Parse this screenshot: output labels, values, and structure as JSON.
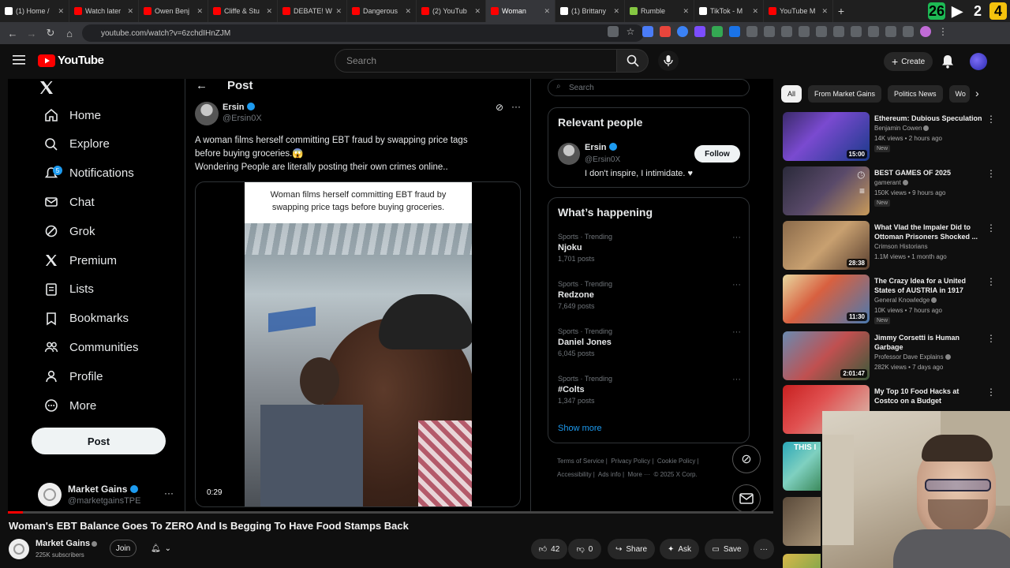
{
  "browser": {
    "tabs": [
      {
        "label": "(1) Home /",
        "favicon_color": "#ffffff"
      },
      {
        "label": "Watch later",
        "favicon_color": "#ff0000"
      },
      {
        "label": "Owen Benj",
        "favicon_color": "#ff0000"
      },
      {
        "label": "Cliffe & Stu",
        "favicon_color": "#ff0000"
      },
      {
        "label": "DEBATE! W",
        "favicon_color": "#ff0000"
      },
      {
        "label": "Dangerous",
        "favicon_color": "#ff0000"
      },
      {
        "label": "(2) YouTub",
        "favicon_color": "#ff0000"
      },
      {
        "label": "Woman",
        "favicon_color": "#ff0000",
        "active": true
      },
      {
        "label": "(1) Brittany",
        "favicon_color": "#ffffff"
      },
      {
        "label": "Rumble",
        "favicon_color": "#85c742"
      },
      {
        "label": "TikTok - M",
        "favicon_color": "#ffffff"
      },
      {
        "label": "YouTube M",
        "favicon_color": "#ff0000"
      }
    ],
    "url": "youtube.com/watch?v=6zchdIHnZJM",
    "hud": [
      "26",
      "2",
      "4"
    ]
  },
  "youtube": {
    "logo_text": "YouTube",
    "search_placeholder": "Search",
    "create_label": "Create"
  },
  "x_post": {
    "nav": [
      {
        "label": "Home",
        "icon": "home-icon"
      },
      {
        "label": "Explore",
        "icon": "search-icon"
      },
      {
        "label": "Notifications",
        "icon": "bell-icon"
      },
      {
        "label": "Chat",
        "icon": "mail-icon"
      },
      {
        "label": "Grok",
        "icon": "grok-icon"
      },
      {
        "label": "Premium",
        "icon": "x-icon"
      },
      {
        "label": "Lists",
        "icon": "list-icon"
      },
      {
        "label": "Bookmarks",
        "icon": "bookmark-icon"
      },
      {
        "label": "Communities",
        "icon": "people-icon"
      },
      {
        "label": "Profile",
        "icon": "person-icon"
      },
      {
        "label": "More",
        "icon": "more-circle-icon"
      }
    ],
    "notification_badge": "5",
    "post_button": "Post",
    "account_name": "Market Gains",
    "account_handle": "@marketgainsTPE",
    "header_title": "Post",
    "author_name": "Ersin",
    "author_handle": "@Ersin0X",
    "text_line1": "A woman films herself committing EBT fraud by swapping price tags",
    "text_line2": "before buying groceries.😱",
    "text_line3": "Wondering People are literally posting their own crimes online..",
    "video_caption": "Woman films herself committing EBT fraud by swapping price tags before buying groceries.",
    "video_time": "0:29",
    "search_placeholder": "Search",
    "relevant_title": "Relevant people",
    "relevant_name": "Ersin",
    "relevant_handle": "@Ersin0X",
    "relevant_bio": "I don't inspire, I intimidate. ♥",
    "follow_label": "Follow",
    "happening_title": "What’s happening",
    "trends": [
      {
        "meta": "Sports · Trending",
        "name": "Njoku",
        "count": "1,701 posts"
      },
      {
        "meta": "Sports · Trending",
        "name": "Redzone",
        "count": "7,649 posts"
      },
      {
        "meta": "Sports · Trending",
        "name": "Daniel Jones",
        "count": "6,045 posts"
      },
      {
        "meta": "Sports · Trending",
        "name": "#Colts",
        "count": "1,347 posts"
      }
    ],
    "show_more": "Show more",
    "footer_links": [
      "Terms of Service",
      "Privacy Policy",
      "Cookie Policy",
      "Accessibility",
      "Ads info",
      "More ···",
      "© 2025 X Corp."
    ]
  },
  "video_info": {
    "title": "Woman's EBT Balance Goes To ZERO And Is Begging To Have Food Stamps Back",
    "channel": "Market Gains",
    "subscribers": "225K subscribers",
    "join_label": "Join",
    "likes": "42",
    "dislikes": "0",
    "share_label": "Share",
    "ask_label": "Ask",
    "save_label": "Save"
  },
  "sidebar": {
    "chips": [
      "All",
      "From Market Gains",
      "Politics News",
      "Wo"
    ],
    "recommendations": [
      {
        "title": "Ethereum: Dubious Speculation",
        "channel": "Benjamin Cowen",
        "meta": "14K views • 2 hours ago",
        "badge": "New",
        "duration": "15:00"
      },
      {
        "title": "BEST GAMES OF 2025",
        "channel": "gamerant",
        "meta": "150K views • 9 hours ago",
        "badge": "New",
        "duration": ""
      },
      {
        "title": "What Vlad the Impaler Did to Ottoman Prisoners Shocked ...",
        "channel": "Crimson Historians",
        "meta": "1.1M views • 1 month ago",
        "badge": "",
        "duration": "28:38"
      },
      {
        "title": "The Crazy Idea for a United States of AUSTRIA in 1917",
        "channel": "General Knowledge",
        "meta": "10K views • 7 hours ago",
        "badge": "New",
        "duration": "11:30"
      },
      {
        "title": "Jimmy Corsetti is Human Garbage",
        "channel": "Professor Dave Explains",
        "meta": "282K views • 7 days ago",
        "badge": "",
        "duration": "2:01:47"
      },
      {
        "title": "My Top 10 Food Hacks at Costco on a Budget",
        "channel": "",
        "meta": "",
        "badge": "",
        "duration": ""
      }
    ]
  }
}
